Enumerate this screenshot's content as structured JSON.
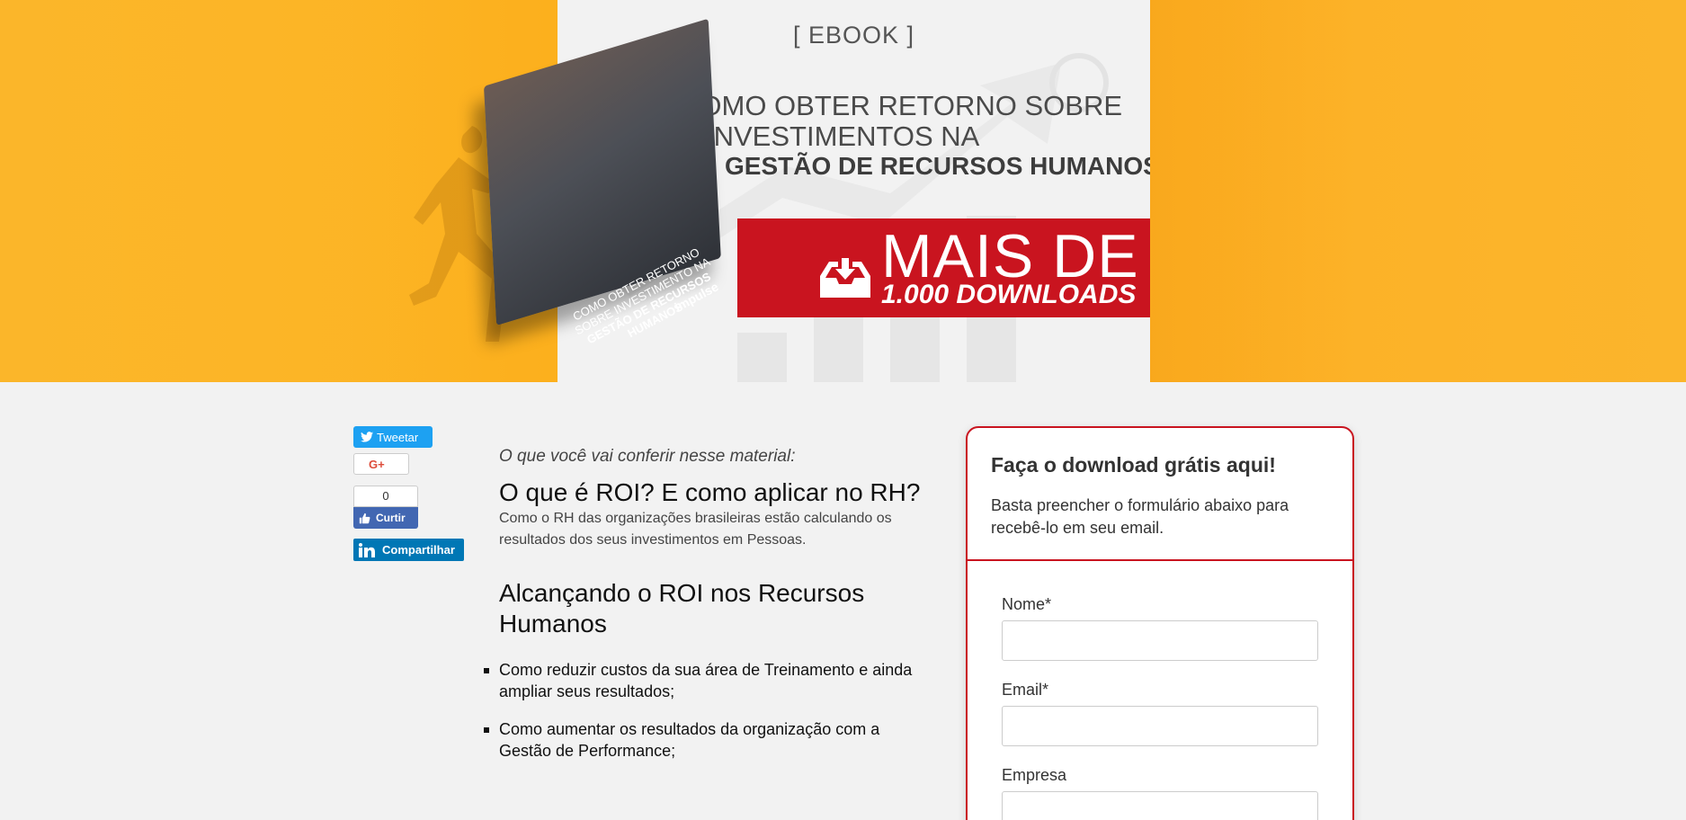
{
  "hero": {
    "label": "[ EBOOK ]",
    "title_line1": "COMO OBTER RETORNO SOBRE",
    "title_line2": "INVESTIMENTOS NA",
    "title_line3": "GESTÃO DE RECURSOS HUMANOS",
    "banner_big": "MAIS DE",
    "banner_small": "1.000 DOWNLOADS",
    "book_title_line1": "COMO OBTER RETORNO",
    "book_title_line2": "SOBRE INVESTIMENTO NA",
    "book_title_line3": "GESTÃO DE RECURSOS HUMANOS",
    "book_brand": "impulse",
    "colors": {
      "accent": "#c9141f",
      "hero_bg": "#fdb424"
    }
  },
  "social": {
    "tweet_label": "Tweetar",
    "gplus_label": "G+",
    "like_count": "0",
    "like_label": "Curtir",
    "linkedin_label": "Compartilhar"
  },
  "article": {
    "intro": "O que você vai conferir nesse material:",
    "section1_title": "O que é ROI? E como aplicar no RH?",
    "section1_text": "Como o RH das organizações brasileiras estão calculando os resultados dos seus investimentos em Pessoas.",
    "section2_title": "Alcançando o ROI nos Recursos Humanos",
    "bullets": [
      " Como reduzir custos da sua área de Treinamento e ainda ampliar seus resultados;",
      "Como aumentar os resultados da organização com a Gestão de Performance;"
    ]
  },
  "form": {
    "title": "Faça o download grátis aqui!",
    "subtitle": "Basta preencher o formulário abaixo para recebê-lo em seu email.",
    "fields": [
      {
        "label": "Nome*",
        "value": ""
      },
      {
        "label": "Email*",
        "value": ""
      },
      {
        "label": "Empresa",
        "value": ""
      }
    ]
  }
}
